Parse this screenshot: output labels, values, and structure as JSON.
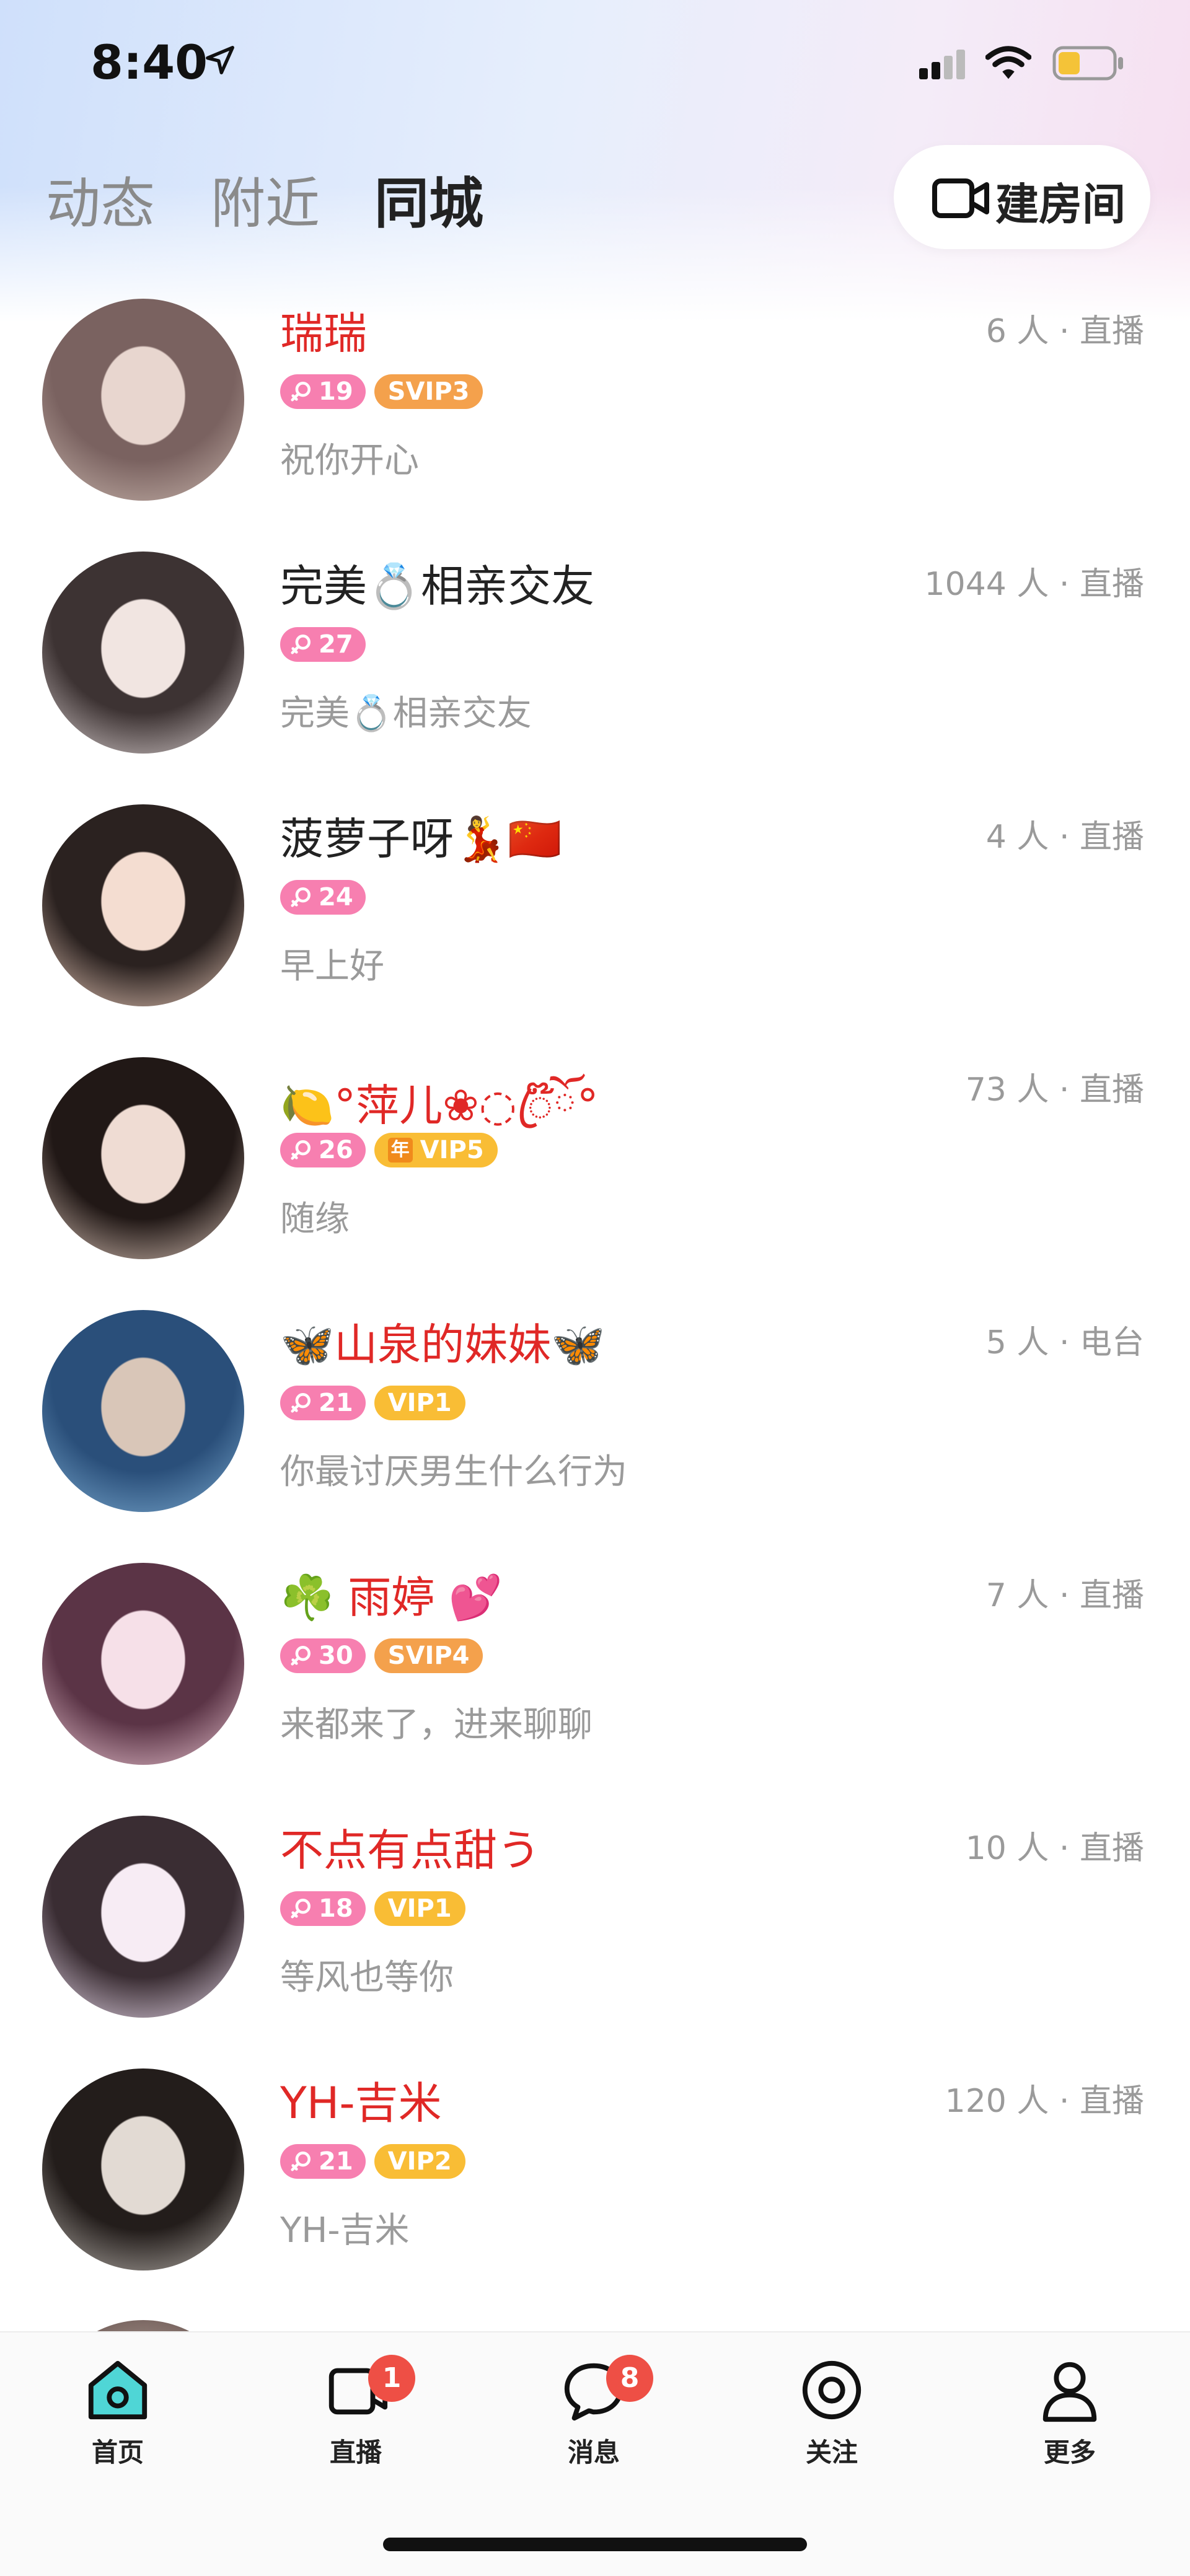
{
  "status_bar": {
    "time": "8:40"
  },
  "tabs": [
    {
      "label": "动态",
      "active": false
    },
    {
      "label": "附近",
      "active": false
    },
    {
      "label": "同城",
      "active": true
    }
  ],
  "create_room": {
    "label": "建房间",
    "icon": "video-camera-icon"
  },
  "rooms": [
    {
      "name": "瑞瑞",
      "name_color": "red",
      "meta": "6 人 · 直播",
      "age": "19",
      "vip": "SVIP3",
      "vip_type": "svip",
      "year": "",
      "signature": "祝你开心",
      "avatar_colors": [
        "#c9b6ad",
        "#7a6260",
        "#e8d6cf"
      ]
    },
    {
      "name": "完美💍相亲交友",
      "name_color": "dark",
      "meta": "1044 人 · 直播",
      "age": "27",
      "vip": "",
      "vip_type": "",
      "year": "",
      "signature": "完美💍相亲交友",
      "avatar_colors": [
        "#d9cfcf",
        "#3d3333",
        "#f1e5e1"
      ]
    },
    {
      "name": "菠萝子呀💃🇨🇳",
      "name_color": "dark",
      "meta": "4 人 · 直播",
      "age": "24",
      "vip": "",
      "vip_type": "",
      "year": "",
      "signature": "早上好",
      "avatar_colors": [
        "#e7c8b8",
        "#2b2220",
        "#f4ddd1"
      ]
    },
    {
      "name": "🍋°萍儿❀◌ꦿ໊ོ°",
      "name_color": "red",
      "meta": "73 人 · 直播",
      "age": "26",
      "vip": "VIP5",
      "vip_type": "vip",
      "year": "年",
      "signature": "随缘",
      "avatar_colors": [
        "#d8c2b6",
        "#211816",
        "#efdcd3"
      ]
    },
    {
      "name": "🦋山泉的妹妹🦋",
      "name_color": "red",
      "meta": "5 人 · 电台",
      "age": "21",
      "vip": "VIP1",
      "vip_type": "vip",
      "year": "",
      "signature": "你最讨厌男生什么行为",
      "avatar_colors": [
        "#7aa9cf",
        "#2a4f7a",
        "#d9c6b8"
      ]
    },
    {
      "name": "☘️ 雨婷 💕",
      "name_color": "red",
      "meta": "7 人 · 直播",
      "age": "30",
      "vip": "SVIP4",
      "vip_type": "svip",
      "year": "",
      "signature": "来都来了，进来聊聊",
      "avatar_colors": [
        "#e8c3cf",
        "#5b3446",
        "#f6e0e8"
      ]
    },
    {
      "name": "不点有点甜う",
      "name_color": "red",
      "meta": "10 人 · 直播",
      "age": "18",
      "vip": "VIP1",
      "vip_type": "vip",
      "year": "",
      "signature": "等风也等你",
      "avatar_colors": [
        "#e6d7e8",
        "#3a2d33",
        "#f7ecf4"
      ]
    },
    {
      "name": "YH-吉米",
      "name_color": "red",
      "meta": "120 人 · 直播",
      "age": "21",
      "vip": "VIP2",
      "vip_type": "vip",
      "year": "",
      "signature": "YH-吉米",
      "avatar_colors": [
        "#b9b3ad",
        "#231d1b",
        "#e2dad3"
      ]
    }
  ],
  "bottom_nav": [
    {
      "label": "首页",
      "icon": "home-icon",
      "badge": "",
      "active": true
    },
    {
      "label": "直播",
      "icon": "live-icon",
      "badge": "1",
      "active": false
    },
    {
      "label": "消息",
      "icon": "message-icon",
      "badge": "8",
      "active": false
    },
    {
      "label": "关注",
      "icon": "eye-icon",
      "badge": "",
      "active": false
    },
    {
      "label": "更多",
      "icon": "person-icon",
      "badge": "",
      "active": false
    }
  ],
  "colors": {
    "accent_red": "#e02826",
    "age_badge": "#f77fb0",
    "vip_badge": "#f9bd35",
    "svip_badge": "#f4a14c",
    "nav_badge": "#ee4f45",
    "home_active": "#4fd6d6"
  }
}
